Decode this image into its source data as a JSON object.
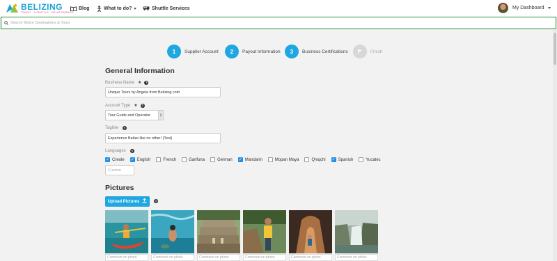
{
  "header": {
    "logo_word": "BELIZING",
    "logo_tagline": "TRAVEL · LIFESTYLE · RELATIONSHIPS",
    "nav": [
      {
        "label": "Blog",
        "icon": "book-icon"
      },
      {
        "label": "What to do?",
        "icon": "person-icon"
      },
      {
        "label": "Shuttle Services",
        "icon": "van-icon"
      }
    ],
    "dashboard_label": "My Dashboard"
  },
  "search": {
    "placeholder": "Search Belize Destinations & Tours"
  },
  "steps": [
    {
      "number": "1",
      "label": "Supplier Account",
      "active": true
    },
    {
      "number": "2",
      "label": "Payout Information",
      "active": true
    },
    {
      "number": "3",
      "label": "Business Certifications",
      "active": true
    },
    {
      "number": "",
      "label": "Finish",
      "active": false
    }
  ],
  "general": {
    "heading": "General Information",
    "business_name_label": "Business Name",
    "business_name_value": "Unique Tours by Angela from Belizing.com",
    "account_type_label": "Account Type",
    "account_type_value": "Tour Guide and Operator",
    "tagline_label": "Tagline",
    "tagline_value": "Experience Belize like no other! (Test)",
    "languages_label": "Languages",
    "languages": [
      {
        "name": "Creole",
        "checked": true
      },
      {
        "name": "English",
        "checked": true
      },
      {
        "name": "French",
        "checked": false
      },
      {
        "name": "Garifuna",
        "checked": false
      },
      {
        "name": "German",
        "checked": false
      },
      {
        "name": "Mandarin",
        "checked": true
      },
      {
        "name": "Mopan Maya",
        "checked": false
      },
      {
        "name": "Q'eqchi",
        "checked": false
      },
      {
        "name": "Spanish",
        "checked": true
      },
      {
        "name": "Yucatec",
        "checked": false
      }
    ],
    "custom_placeholder": "Custom",
    "required_mark": "★"
  },
  "pictures": {
    "heading": "Pictures",
    "upload_label": "Upload Pictures",
    "comment_placeholder": "Comment on photo",
    "photos": [
      "kayak",
      "snorkel",
      "maya-ruins",
      "cliff",
      "cave",
      "waterfall"
    ]
  },
  "colors": {
    "accent": "#1ea7e1",
    "search_border": "#2b8a3e",
    "checkbox": "#1f8ee8"
  }
}
